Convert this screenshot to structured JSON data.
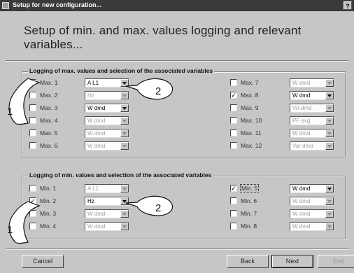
{
  "window": {
    "title": "Setup for new configuration...",
    "help_label": "?"
  },
  "heading": "Setup of min. and max. values logging and relevant variables...",
  "max_group": {
    "legend": "Logging of max. values and selection of the associated variables",
    "rows": [
      {
        "label": "Max. 1",
        "checked": true,
        "value": "A L1",
        "enabled": true
      },
      {
        "label": "Max. 2",
        "checked": false,
        "value": "Hz",
        "enabled": false
      },
      {
        "label": "Max. 3",
        "checked": false,
        "value": "W dmd",
        "enabled": true
      },
      {
        "label": "Max. 4",
        "checked": false,
        "value": "W dmd",
        "enabled": false
      },
      {
        "label": "Max. 5",
        "checked": false,
        "value": "W dmd",
        "enabled": false
      },
      {
        "label": "Max. 6",
        "checked": false,
        "value": "W dmd",
        "enabled": false
      },
      {
        "label": "Max. 7",
        "checked": false,
        "value": "W dmd",
        "enabled": false
      },
      {
        "label": "Max. 8",
        "checked": true,
        "value": "W dmd",
        "enabled": true
      },
      {
        "label": "Max. 9",
        "checked": false,
        "value": "VA dmd",
        "enabled": false
      },
      {
        "label": "Max. 10",
        "checked": false,
        "value": "PF avg",
        "enabled": false
      },
      {
        "label": "Max. 11",
        "checked": false,
        "value": "W dmd",
        "enabled": false
      },
      {
        "label": "Max. 12",
        "checked": false,
        "value": "Var dmd",
        "enabled": false
      }
    ]
  },
  "min_group": {
    "legend": "Logging of min. values and selection of the associated variables",
    "rows": [
      {
        "label": "Min. 1",
        "checked": false,
        "value": "A L1",
        "enabled": false
      },
      {
        "label": "Min. 2",
        "checked": true,
        "value": "Hz",
        "enabled": true
      },
      {
        "label": "Min. 3",
        "checked": false,
        "value": "W dmd",
        "enabled": false
      },
      {
        "label": "Min. 4",
        "checked": false,
        "value": "W dmd",
        "enabled": false
      },
      {
        "label": "Min. 5",
        "checked": true,
        "value": "W dmd",
        "enabled": true
      },
      {
        "label": "Min. 6",
        "checked": false,
        "value": "W dmd",
        "enabled": false
      },
      {
        "label": "Min. 7",
        "checked": false,
        "value": "W dmd",
        "enabled": false
      },
      {
        "label": "Min. 8",
        "checked": false,
        "value": "W dmd",
        "enabled": false
      }
    ]
  },
  "callouts": {
    "one": "1",
    "two": "2"
  },
  "buttons": {
    "cancel": "Cancel",
    "back": "Back",
    "next": "Next",
    "end": "End"
  },
  "icons": {
    "window": "app-window-icon",
    "check": "checkmark-icon",
    "dropdown": "chevron-down-icon"
  }
}
